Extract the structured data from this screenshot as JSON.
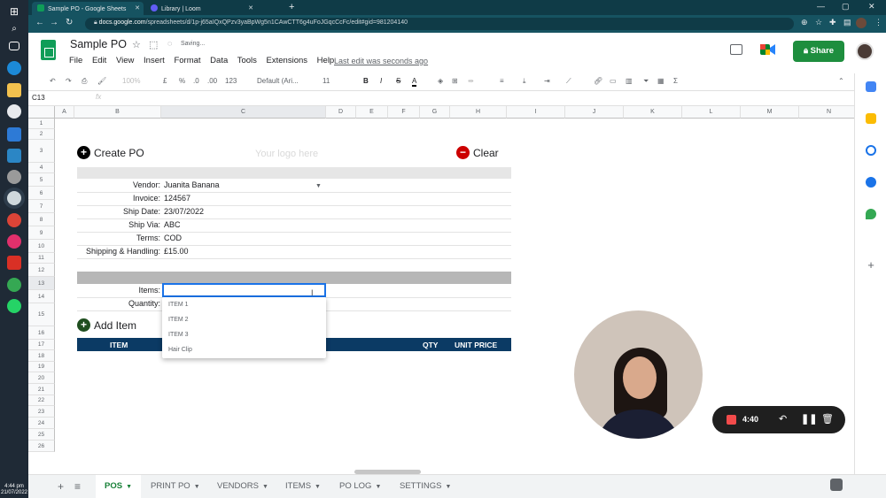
{
  "taskbar": {
    "time": "4:44 pm",
    "date": "21/07/2022"
  },
  "browser": {
    "tabs": [
      {
        "title": "Sample PO - Google Sheets"
      },
      {
        "title": "Library | Loom"
      }
    ],
    "url_host": "docs.google.com",
    "url_path": "/spreadsheets/d/1p-j65aIQxQPzv3yaBpWg5n1CAwCTT6g4uFoJGqcCcFc/edit#gid=981204140"
  },
  "sheets": {
    "doc_title": "Sample PO",
    "saving": "Saving...",
    "menu": [
      "File",
      "Edit",
      "View",
      "Insert",
      "Format",
      "Data",
      "Tools",
      "Extensions",
      "Help"
    ],
    "last_edit": "Last edit was seconds ago",
    "share_label": "Share"
  },
  "toolbar": {
    "zoom": "100%",
    "currency": "£",
    "percent": "%",
    "dec_less": ".0",
    "dec_more": ".00",
    "format_more": "123",
    "font": "Default (Ari...",
    "font_size": "11",
    "bold": "B",
    "italic": "I",
    "strike": "S",
    "text_color": "A"
  },
  "formula_bar": {
    "cell_ref": "C13",
    "fx": "fx"
  },
  "columns": [
    "A",
    "B",
    "C",
    "D",
    "E",
    "F",
    "G",
    "H",
    "I",
    "J",
    "K",
    "L",
    "M",
    "N"
  ],
  "rows": [
    "1",
    "2",
    "3",
    "4",
    "5",
    "6",
    "7",
    "8",
    "9",
    "10",
    "11",
    "12",
    "13",
    "14",
    "15",
    "16",
    "17",
    "18",
    "19",
    "20",
    "21",
    "22",
    "23",
    "24",
    "25",
    "26"
  ],
  "po": {
    "create_label": "Create PO",
    "logo_placeholder": "Your logo here",
    "clear_label": "Clear",
    "fields": [
      {
        "label": "Vendor:",
        "value": "Juanita Banana"
      },
      {
        "label": "Invoice:",
        "value": "124567"
      },
      {
        "label": "Ship Date:",
        "value": "23/07/2022"
      },
      {
        "label": "Ship Via:",
        "value": "ABC"
      },
      {
        "label": "Terms:",
        "value": "COD"
      },
      {
        "label": "Shipping & Handling:",
        "value": "£15.00"
      }
    ],
    "items_label": "Items:",
    "quantity_label": "Quantity:",
    "add_item_label": "Add Item",
    "table_headers": {
      "item": "ITEM",
      "qty": "QTY",
      "unit_price": "UNIT PRICE"
    },
    "dropdown_options": [
      "ITEM 1",
      "ITEM 2",
      "ITEM 3",
      "Hair Clip"
    ]
  },
  "sheet_tabs": [
    "POS",
    "PRINT PO",
    "VENDORS",
    "ITEMS",
    "PO LOG",
    "SETTINGS"
  ],
  "loom": {
    "timer": "4:40"
  }
}
